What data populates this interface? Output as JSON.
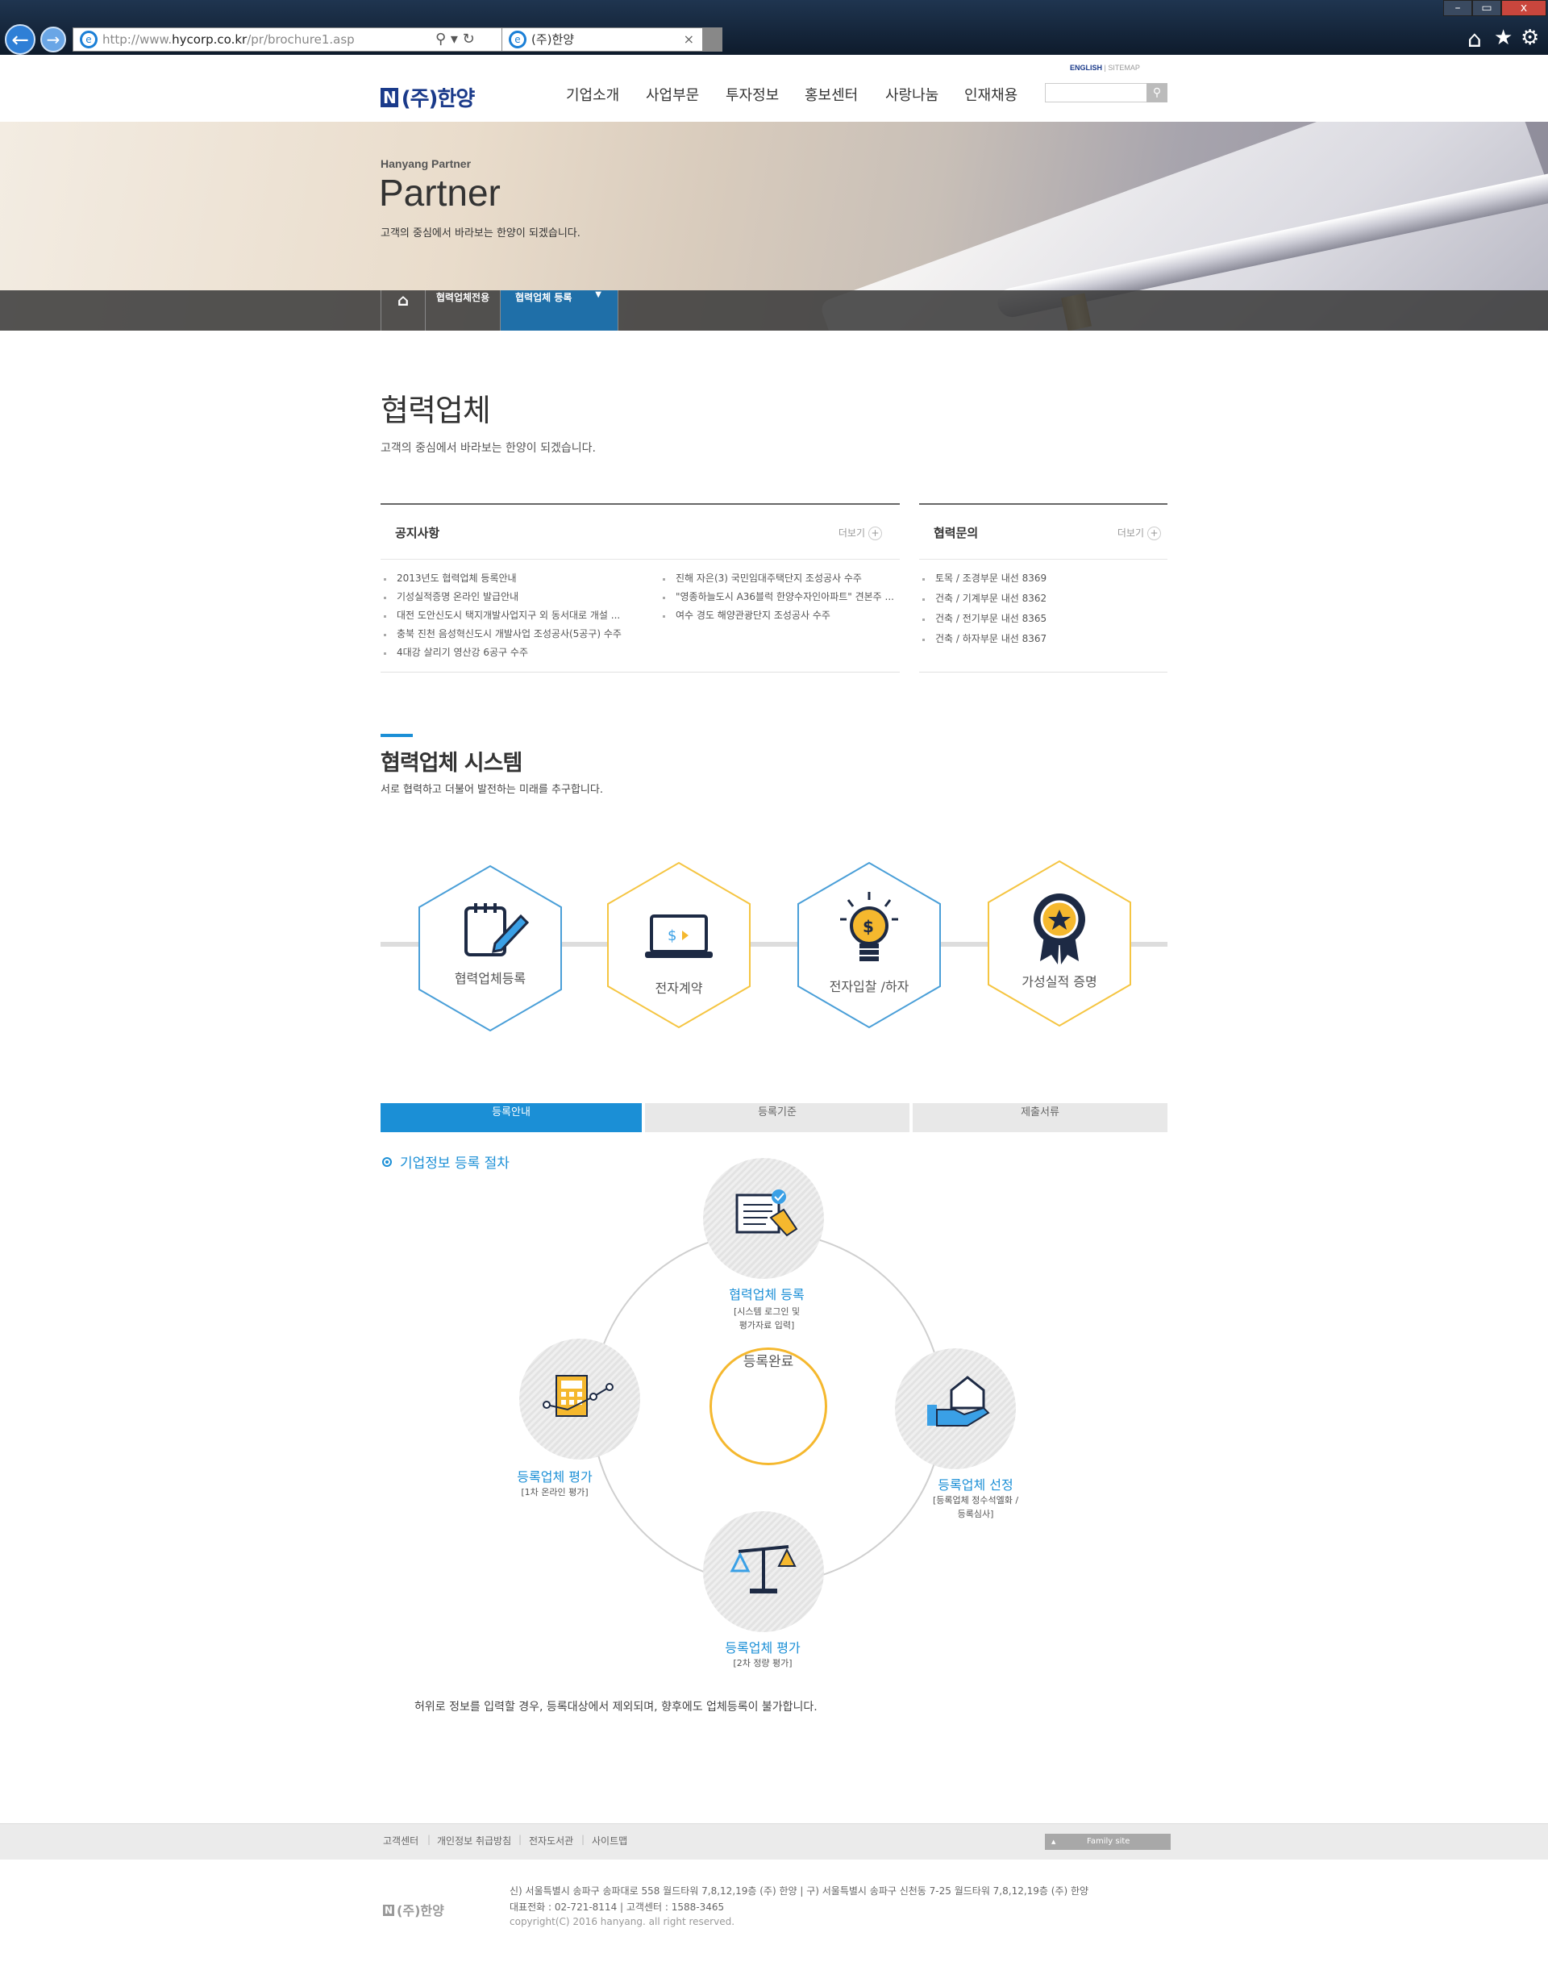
{
  "browser": {
    "url_prefix": "http://www.",
    "url_domain": "hycorp.co.kr",
    "url_path": "/pr/brochure1.asp",
    "tab_title": "(주)한양",
    "tab_close": "×",
    "addr_icons": "⚲ ▾ ↻",
    "back_icon": "←",
    "forward_icon": "→",
    "win_min": "–",
    "win_max": "▭",
    "win_close": "x",
    "home_icon": "⌂",
    "fav_icon": "★",
    "tools_icon": "⚙"
  },
  "header": {
    "logo_mark": "N",
    "logo_text": "(주)한양",
    "util_english": "ENGLISH",
    "util_sep": " | ",
    "util_sitemap": "SITEMAP",
    "search_placeholder": "",
    "search_icon": "⚲",
    "gnb": [
      "기업소개",
      "사업부문",
      "투자정보",
      "홍보센터",
      "사랑나눔",
      "인재채용"
    ]
  },
  "hero": {
    "subtitle": "Hanyang Partner",
    "title": "Partner",
    "desc": "고객의 중심에서 바라보는 한양이 되겠습니다."
  },
  "lnb": {
    "home_icon": "⌂",
    "item1": "협력업체전용",
    "item2": "협력업체 등록",
    "arrow": "▼"
  },
  "page": {
    "title": "협력업체",
    "desc": "고객의 중심에서 바라보는 한양이 되겠습니다."
  },
  "notice": {
    "title": "공지사항",
    "more": "더보기",
    "more_icon": "+",
    "col1": [
      "2013년도 협력업체 등록안내",
      "기성실적증명 온라인 발급안내",
      "대전 도안신도시 택지개발사업지구 외 동서대로 개설 ...",
      "충북 진천 음성혁신도시 개발사업 조성공사(5공구) 수주",
      "4대강 살리기 영산강 6공구 수주"
    ],
    "col2": [
      "진해 자은(3) 국민임대주택단지 조성공사 수주",
      "\"영종하늘도시 A36블럭 한양수자인아파트\" 견본주 ...",
      "여수 경도 해양관광단지 조성공사 수주"
    ]
  },
  "inquiry": {
    "title": "협력문의",
    "more": "더보기",
    "more_icon": "+",
    "items": [
      "토목 / 조경부문 내선 8369",
      "건축 / 기계부문 내선 8362",
      "건축 / 전기부문 내선 8365",
      "건축 / 하자부문 내선 8367"
    ]
  },
  "system": {
    "title": "협력업체 시스템",
    "desc": "서로 협력하고 더불어 발전하는 미래를 추구합니다.",
    "hexes": [
      {
        "label": "협력업체등록",
        "icon": "notepad-pencil-icon",
        "color": "#4a9fd8"
      },
      {
        "label": "전자계약",
        "icon": "laptop-contract-icon",
        "color": "#f5c542"
      },
      {
        "label": "전자입찰 /하자",
        "icon": "lightbulb-dollar-icon",
        "color": "#4a9fd8"
      },
      {
        "label": "가성실적 증명",
        "icon": "award-badge-icon",
        "color": "#f5c542"
      }
    ]
  },
  "tabs": [
    "등록안내",
    "등록기준",
    "제출서류"
  ],
  "process": {
    "title": "기업정보 등록 절차",
    "center": "등록완료",
    "steps": [
      {
        "title": "협력업체 등록",
        "desc1": "[시스템 로그인 및",
        "desc2": "평가자료 입력]",
        "icon": "document-pen-icon"
      },
      {
        "title": "등록업체 선정",
        "desc1": "[등록업체 정수석엘화 /",
        "desc2": "등록심사]",
        "icon": "hand-house-icon"
      },
      {
        "title": "등록업체 평가",
        "desc1": "[2차 정량 평가]",
        "desc2": "",
        "icon": "scale-icon"
      },
      {
        "title": "등록업체 평가",
        "desc1": "[1차 온라인 평가]",
        "desc2": "",
        "icon": "calculator-graph-icon"
      }
    ],
    "notice": "허위로 정보를 입력할 경우, 등록대상에서 제외되며, 향후에도 업체등록이 불가합니다."
  },
  "footer": {
    "links": [
      "고객센터",
      "개인정보 취급방침",
      "전자도서관",
      "사이트맵"
    ],
    "sep": "|",
    "family": "Family site",
    "logo_mark": "N",
    "logo_text": "(주)한양",
    "addr": "신) 서울특별시 송파구 송파대로 558 월드타워 7,8,12,19층 (주) 한양  |  구) 서울특별시 송파구 신천동 7-25 월드타워 7,8,12,19층 (주) 한양",
    "tel": "대표전화 : 02-721-8114  |  고객센터 : 1588-3465",
    "copy": "copyright(C) 2016 hanyang. all right reserved."
  }
}
